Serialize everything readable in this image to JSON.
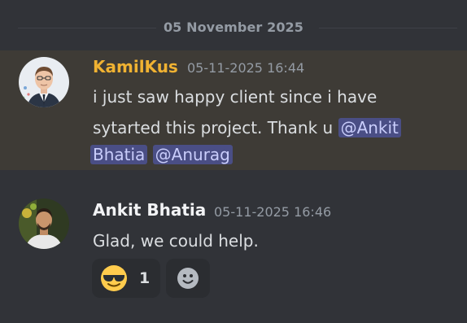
{
  "date_divider": "05 November 2025",
  "messages": [
    {
      "author": "KamilKus",
      "timestamp": "05-11-2025 16:44",
      "line1": "i just saw happy client since i have",
      "line2_text": "sytarted this project. Thank u ",
      "mention1_part1": "@Ankit",
      "mention1_part2": "Bhatia",
      "mention2": "@Anurag",
      "author_color": "#f0b232",
      "highlighted": true
    },
    {
      "author": "Ankit Bhatia",
      "timestamp": "05-11-2025 16:46",
      "text": "Glad, we could help.",
      "author_color": "#f2f3f5"
    }
  ],
  "reactions": [
    {
      "emoji": "sunglasses-emoji",
      "count": "1"
    },
    {
      "emoji": "add-reaction-icon"
    }
  ]
}
